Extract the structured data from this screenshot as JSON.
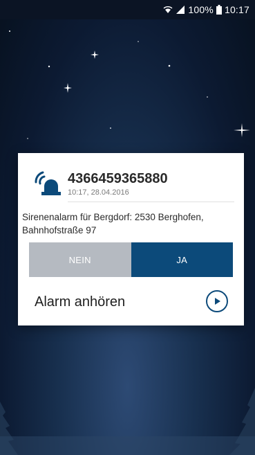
{
  "status_bar": {
    "icons": [
      "wifi-icon",
      "signal-icon",
      "battery-icon"
    ],
    "battery": "100%",
    "time": "10:17"
  },
  "alert": {
    "icon": "siren-icon",
    "number": "4366459365880",
    "timestamp": "10:17, 28.04.2016",
    "message": "Sirenenalarm für Bergdorf: 2530 Berghofen, Bahnhofstraße 97",
    "decline_label": "NEIN",
    "accept_label": "JA",
    "listen_label": "Alarm anhören",
    "play_icon": "play-icon"
  },
  "colors": {
    "accent": "#0c4a7a",
    "decline": "#b5bac1",
    "background": "#0c1a32"
  }
}
